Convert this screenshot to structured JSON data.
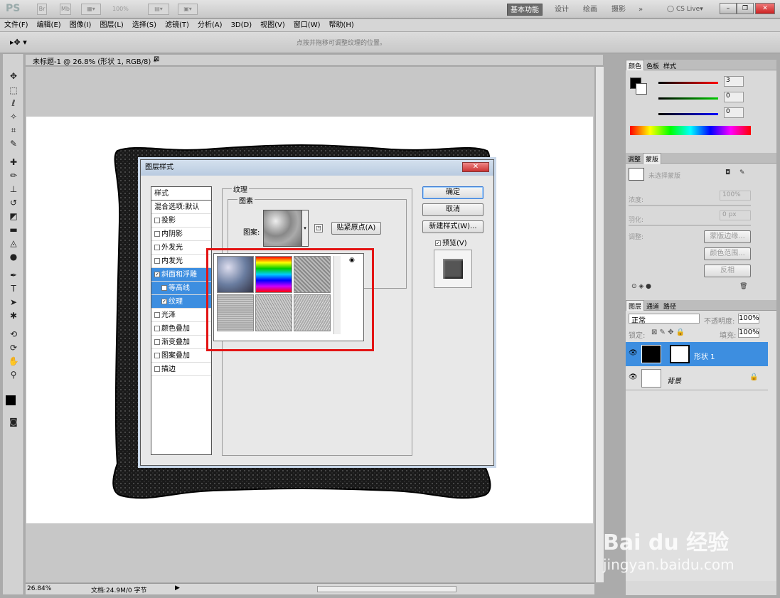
{
  "app": {
    "logo": "PS",
    "zoom": "100%",
    "workspaces": [
      "基本功能",
      "设计",
      "绘画",
      "摄影"
    ],
    "more": "»",
    "cslive": "CS Live"
  },
  "menu": [
    "文件(F)",
    "编辑(E)",
    "图像(I)",
    "图层(L)",
    "选择(S)",
    "滤镜(T)",
    "分析(A)",
    "3D(D)",
    "视图(V)",
    "窗口(W)",
    "帮助(H)"
  ],
  "options": {
    "hint": "点按并拖移可调整纹理的位置。"
  },
  "document": {
    "tab": "未标题-1 @ 26.8% (形状 1, RGB/8) *",
    "status_zoom": "26.84%",
    "status_doc": "文档:24.9M/0 字节"
  },
  "dialog": {
    "title": "图层样式",
    "list_header": "样式",
    "blend": "混合选项:默认",
    "items": [
      "投影",
      "内阴影",
      "外发光",
      "内发光",
      "斜面和浮雕",
      "等高线",
      "纹理",
      "光泽",
      "颜色叠加",
      "渐变叠加",
      "图案叠加",
      "描边"
    ],
    "checked": [
      false,
      false,
      false,
      false,
      true,
      false,
      true,
      false,
      false,
      false,
      false,
      false
    ],
    "texture_group": "纹理",
    "elements_group": "图素",
    "pattern_label": "图案:",
    "snap_button": "贴紧原点(A)",
    "ok": "确定",
    "cancel": "取消",
    "new_style": "新建样式(W)...",
    "preview": "预览(V)"
  },
  "color_panel": {
    "tabs": [
      "颜色",
      "色板",
      "样式"
    ],
    "r": "3",
    "g": "0",
    "b": "0"
  },
  "mask_panel": {
    "tabs": [
      "调整",
      "蒙版"
    ],
    "no_mask": "未选择蒙版",
    "density_label": "浓度:",
    "density": "100%",
    "feather_label": "羽化:",
    "feather": "0 px",
    "adjust_label": "调整:",
    "mask_edge": "蒙版边缘...",
    "color_range": "颜色范围...",
    "invert": "反相"
  },
  "layers_panel": {
    "tabs": [
      "图层",
      "通道",
      "路径"
    ],
    "mode": "正常",
    "opacity_label": "不透明度:",
    "opacity": "100%",
    "lock_label": "锁定:",
    "fill_label": "填充:",
    "fill": "100%",
    "layers": [
      "形状 1",
      "背景"
    ]
  },
  "watermark": {
    "brand": "Bai du 经验",
    "url": "jingyan.baidu.com"
  }
}
